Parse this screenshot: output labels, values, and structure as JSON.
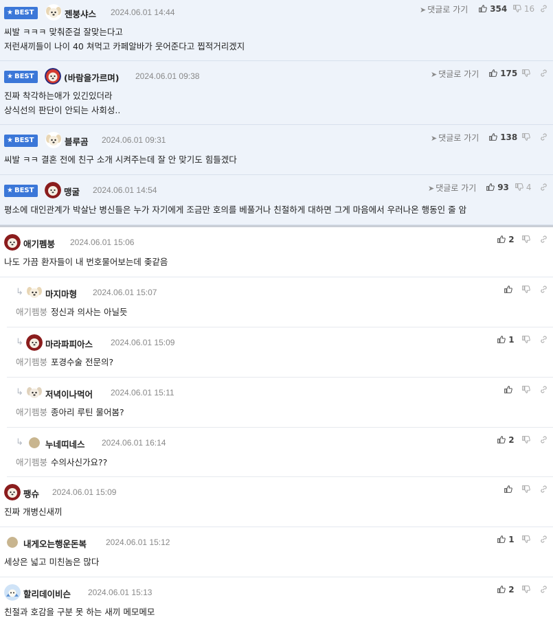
{
  "labels": {
    "best": "BEST",
    "goto_reply": "댓글로 가기"
  },
  "best_comments": [
    {
      "author": "젠붕샤스",
      "date": "2024.06.01 14:44",
      "lines": [
        "씨발 ㅋㅋㅋ 맞춰준걸 잘맞는다고",
        "저런새끼들이 나이 40 쳐먹고 카페알바가 웃어준다고 찝적거리겠지"
      ],
      "likes": "354",
      "dislikes": "16"
    },
    {
      "author": "(바람을가르며)",
      "date": "2024.06.01 09:38",
      "lines": [
        "진짜 착각하는애가 있긴있더라",
        "상식선의 판단이 안되는 사회성.."
      ],
      "likes": "175",
      "dislikes": ""
    },
    {
      "author": "블루곰",
      "date": "2024.06.01 09:31",
      "lines": [
        "씨발 ㅋㅋ 결혼 전에 친구 소개 시켜주는데 잘 안 맞기도 힘들겠다"
      ],
      "likes": "138",
      "dislikes": ""
    },
    {
      "author": "맹굴",
      "date": "2024.06.01 14:54",
      "lines": [
        "평소에 대인관계가 박살난 병신들은 누가 자기에게 조금만 호의를 베풀거나 친절하게 대하면 그게 마음에서 우러나온 행동인 줄 암"
      ],
      "likes": "93",
      "dislikes": "4"
    }
  ],
  "comments": [
    {
      "author": "애기펨붕",
      "date": "2024.06.01 15:06",
      "text": "나도 가끔 환자들이 내 번호물어보는데 좆같음",
      "likes": "2"
    },
    {
      "author": "마지마형",
      "date": "2024.06.01 15:07",
      "mention": "애기펨붕",
      "text": "정신과 의사는 아닐듯",
      "likes": ""
    },
    {
      "author": "마라파피아스",
      "date": "2024.06.01 15:09",
      "mention": "애기펨붕",
      "text": "포경수술 전문의?",
      "likes": "1"
    },
    {
      "author": "저녁이나먹어",
      "date": "2024.06.01 15:11",
      "mention": "애기펨붕",
      "text": "종아리 루틴 물어봄?",
      "likes": ""
    },
    {
      "author": "누네띠네스",
      "date": "2024.06.01 16:14",
      "mention": "애기펨붕",
      "text": "수의사신가요??",
      "likes": "2"
    },
    {
      "author": "팽슈",
      "date": "2024.06.01 15:09",
      "text": "진짜 개병신새끼",
      "likes": ""
    },
    {
      "author": "내게오는행운돈복",
      "date": "2024.06.01 15:12",
      "text": "세상은 넓고 미친놈은 많다",
      "likes": "1"
    },
    {
      "author": "할리데이비슨",
      "date": "2024.06.01 15:13",
      "text": "친절과 호감을 구분 못 하는 새끼 메모메모",
      "likes": "2"
    }
  ],
  "icons": {
    "like": "thumbs-up-icon",
    "dislike": "thumbs-down-icon",
    "share": "link-icon",
    "reply": "reply-arrow-icon",
    "goto": "navigation-arrow-icon"
  },
  "colors": {
    "best_badge": "#3b77d8",
    "best_background": "#eef3fa",
    "date": "#888888",
    "mention": "#8c8c8c"
  }
}
